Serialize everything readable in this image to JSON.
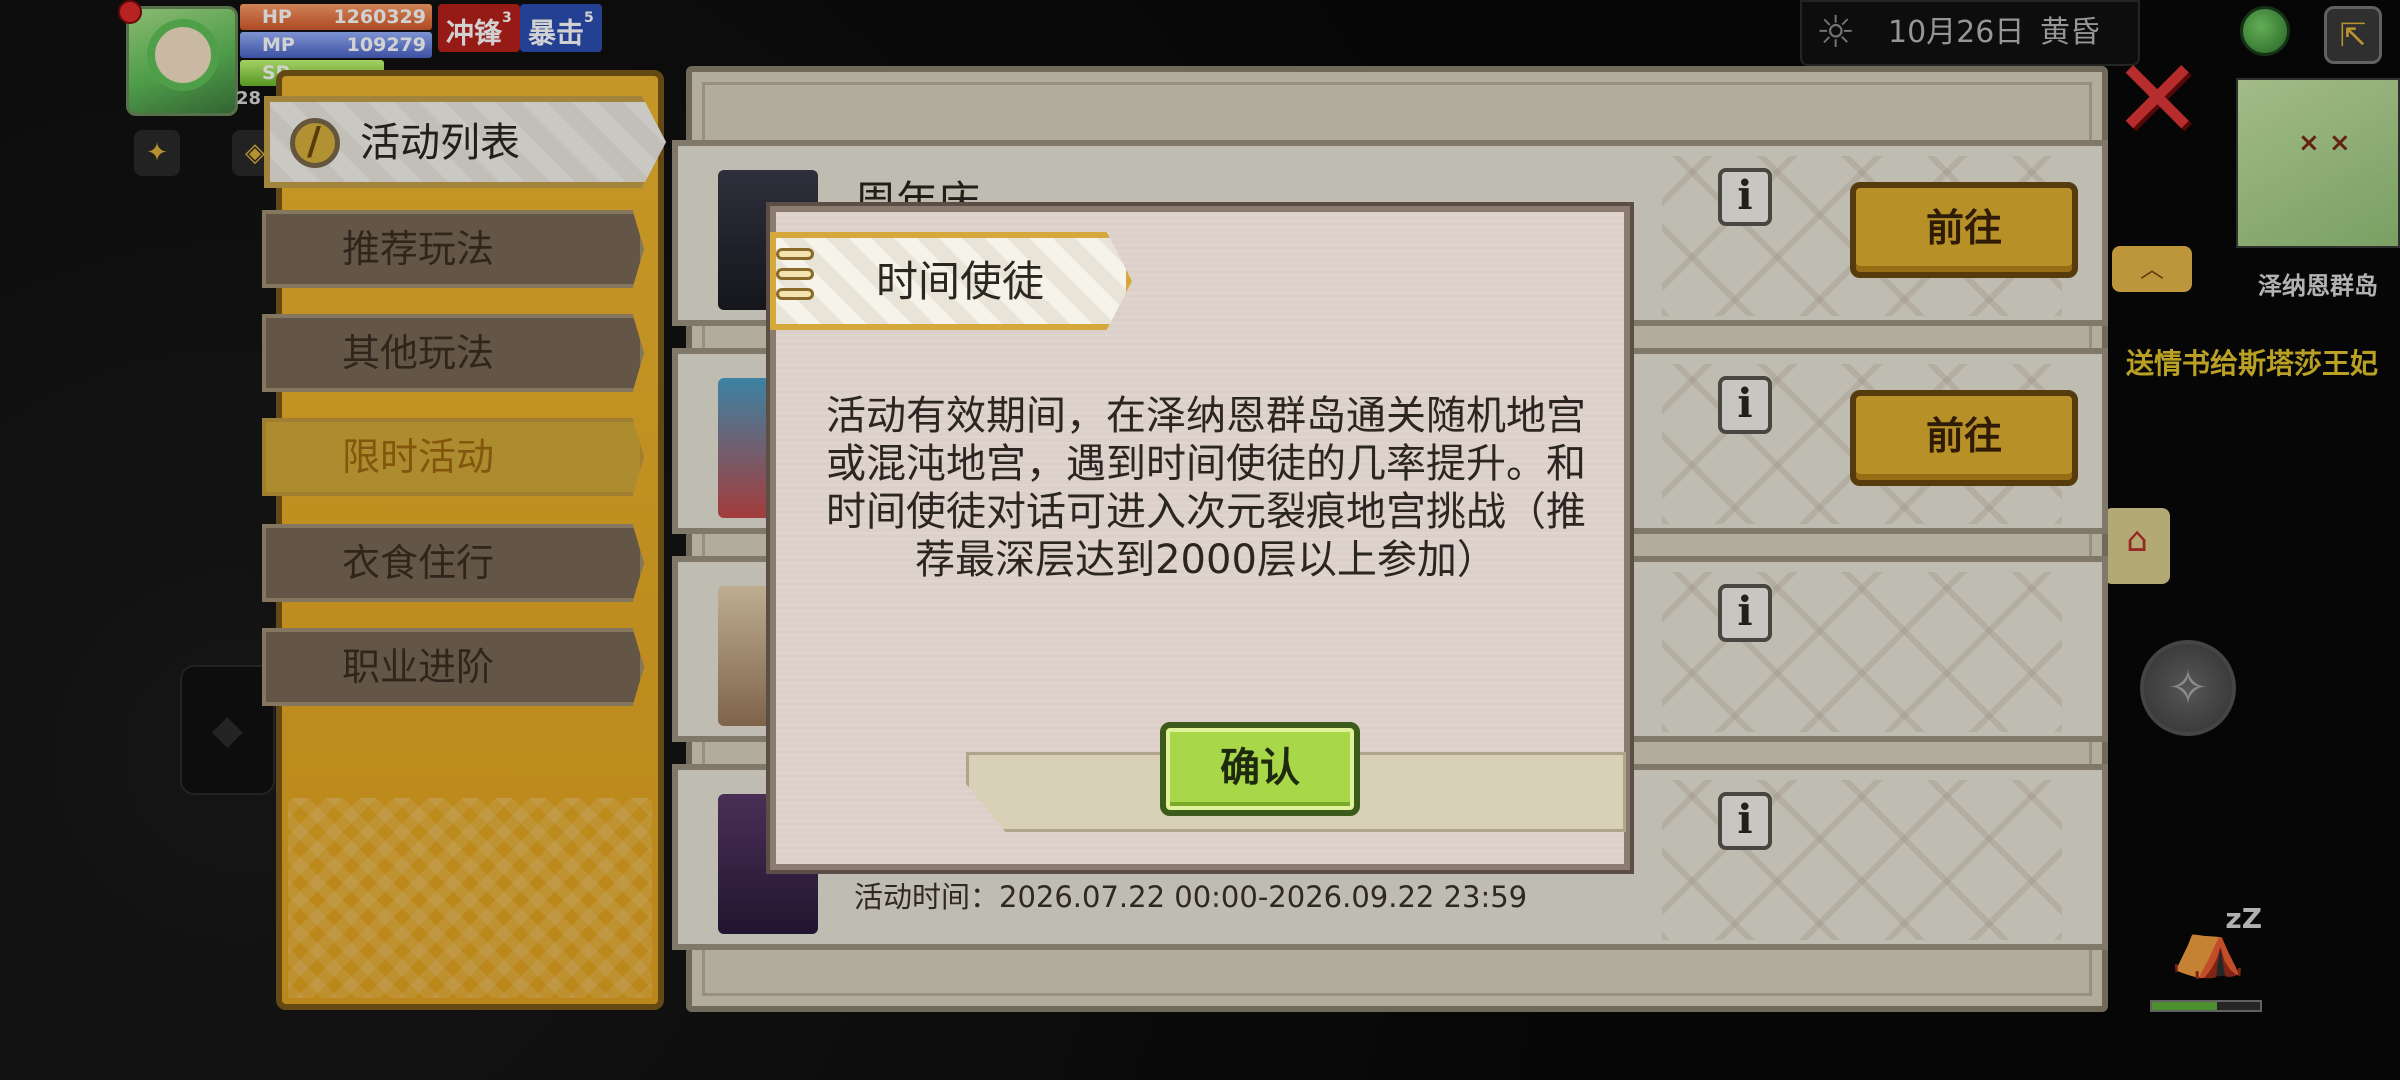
{
  "hud": {
    "hp_label": "HP",
    "hp_value": "1260329",
    "mp_label": "MP",
    "mp_value": "109279",
    "sp_label": "SP",
    "level": "28",
    "buffs": [
      {
        "label": "冲锋",
        "count": "3"
      },
      {
        "label": "暴击",
        "count": "5"
      }
    ],
    "colors": {
      "hp": "#d45a2b",
      "mp": "#4a63c7",
      "sp": "#6bb82b"
    }
  },
  "topbar": {
    "date": "10月26日",
    "period": "黄昏",
    "weather_icon": "sun-icon",
    "network_icon": "globe-icon",
    "exit_icon": "exit-icon"
  },
  "minimap": {
    "location": "泽纳恩群岛",
    "quest": "送情书给斯塔莎王妃"
  },
  "sidebar": {
    "header": "活动列表",
    "items": [
      {
        "label": "推荐玩法",
        "active": false
      },
      {
        "label": "其他玩法",
        "active": false
      },
      {
        "label": "限时活动",
        "active": true
      },
      {
        "label": "衣食住行",
        "active": false
      },
      {
        "label": "职业进阶",
        "active": false
      }
    ]
  },
  "activities": [
    {
      "title": "周年庆",
      "button": "前往"
    },
    {
      "title": "",
      "button": "前往"
    },
    {
      "title": "",
      "button": ""
    },
    {
      "title": "",
      "button": "",
      "time": "活动时间：2026.07.22 00:00-2026.09.22 23:59"
    }
  ],
  "modal": {
    "title": "时间使徒",
    "body": "活动有效期间，在泽纳恩群岛通关随机地宫或混沌地宫，遇到时间使徒的几率提升。和时间使徒对话可进入次元裂痕地宫挑战（推荐最深层达到2000层以上参加）",
    "confirm": "确认"
  },
  "colors": {
    "panel_gold": "#e5a520",
    "go_button": "#e0b030",
    "confirm_button": "#a8d84a",
    "close_red": "#e03838"
  }
}
